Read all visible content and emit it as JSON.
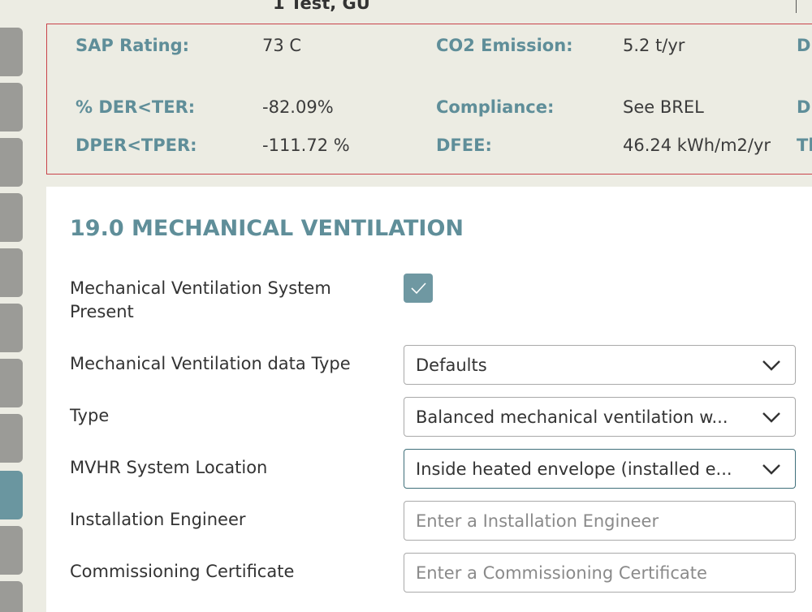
{
  "header": {
    "property_title": "1 Test, GU"
  },
  "summary": {
    "rows": [
      {
        "label": "SAP Rating:",
        "value": "73 C",
        "label2": "CO2 Emission:",
        "value2": "5.2 t/yr",
        "label3": "D"
      },
      {
        "label": "% DER<TER:",
        "value": "-82.09%",
        "label2": "Compliance:",
        "value2": "See BREL",
        "label3": "D"
      },
      {
        "label": "DPER<TPER:",
        "value": "-111.72 %",
        "label2": "DFEE:",
        "value2": "46.24 kWh/m2/yr",
        "label3": "Tl"
      }
    ]
  },
  "section": {
    "title": "19.0 MECHANICAL VENTILATION"
  },
  "form": {
    "mv_present_label": "Mechanical Ventilation System Present",
    "mv_present_checked": true,
    "data_type_label": "Mechanical Ventilation data Type",
    "data_type_value": "Defaults",
    "type_label": "Type",
    "type_value": "Balanced mechanical ventilation w...",
    "location_label": "MVHR System Location",
    "location_value": "Inside heated envelope (installed e...",
    "engineer_label": "Installation Engineer",
    "engineer_placeholder": "Enter a Installation Engineer",
    "certificate_label": "Commissioning Certificate",
    "certificate_placeholder": "Enter a Commissioning Certificate"
  },
  "colors": {
    "accent": "#5f8e99",
    "alert_border": "#c9434a",
    "checkbox": "#6f98a2",
    "background": "#ecece3"
  },
  "icons": {
    "checkbox": "check-icon",
    "dropdown": "chevron-down-icon"
  }
}
